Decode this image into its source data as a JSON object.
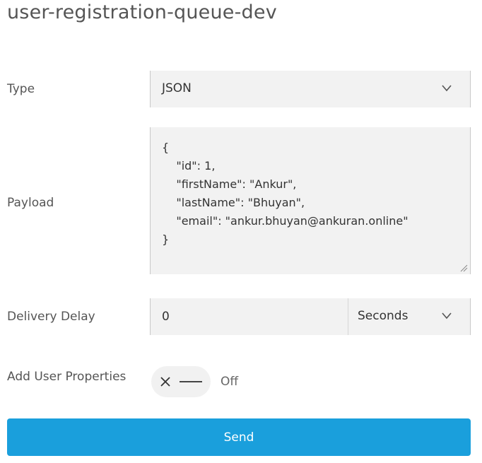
{
  "page": {
    "title": "user-registration-queue-dev"
  },
  "form": {
    "type": {
      "label": "Type",
      "value": "JSON",
      "icon": "chevron-down-icon"
    },
    "payload": {
      "label": "Payload",
      "value": "{\n    \"id\": 1,\n    \"firstName\": \"Ankur\",\n    \"lastName\": \"Bhuyan\",\n    \"email\": \"ankur.bhuyan@ankuran.online\"\n}"
    },
    "delivery_delay": {
      "label": "Delivery Delay",
      "value": "0",
      "unit": "Seconds",
      "icon": "chevron-down-icon"
    },
    "user_properties": {
      "label": "Add User Properties",
      "state": "Off",
      "enabled": false
    },
    "send_label": "Send"
  },
  "colors": {
    "accent": "#1a9fdc",
    "field_background": "#f2f2f2"
  }
}
